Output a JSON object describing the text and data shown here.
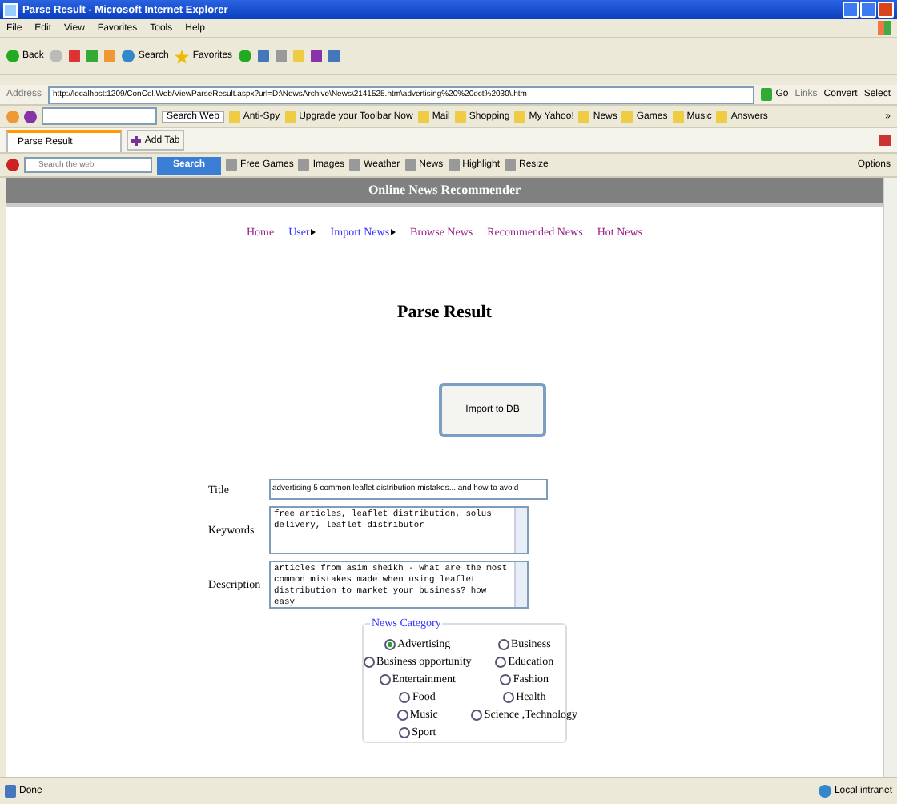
{
  "window": {
    "title": "Parse Result - Microsoft Internet Explorer"
  },
  "menu": [
    "File",
    "Edit",
    "View",
    "Favorites",
    "Tools",
    "Help"
  ],
  "nav_toolbar": {
    "back": "Back",
    "search": "Search",
    "favorites": "Favorites"
  },
  "address_bar": {
    "label": "Address",
    "url": "http://localhost:1209/ConCol.Web/ViewParseResult.aspx?url=D:\\NewsArchive\\News\\2141525.htm\\advertising%20%20oct%2030\\.htm",
    "go": "Go",
    "links": "Links",
    "convert": "Convert",
    "select": "Select"
  },
  "yahoo_toolbar": {
    "search_button": "Search Web",
    "items": [
      "Anti-Spy",
      "Upgrade your Toolbar Now",
      "Mail",
      "Shopping",
      "My Yahoo!",
      "News",
      "Games",
      "Music",
      "Answers"
    ],
    "more": "»"
  },
  "tabs": [
    {
      "label": "Parse Result",
      "selected": true
    }
  ],
  "add_tab": "Add Tab",
  "search_toolbar": {
    "placeholder": "Search the web",
    "button": "Search",
    "items": [
      "Free Games",
      "Images",
      "Weather",
      "News",
      "Highlight",
      "Resize"
    ],
    "options": "Options"
  },
  "page": {
    "header": "Online News Recommender",
    "nav": [
      {
        "label": "Home",
        "visited": true,
        "submenu": false
      },
      {
        "label": "User",
        "visited": false,
        "submenu": true
      },
      {
        "label": "Import News",
        "visited": false,
        "submenu": true
      },
      {
        "label": "Browse News",
        "visited": true,
        "submenu": false
      },
      {
        "label": "Recommended News",
        "visited": true,
        "submenu": false
      },
      {
        "label": "Hot News",
        "visited": true,
        "submenu": false
      }
    ],
    "heading": "Parse Result",
    "import_button": "Import to DB",
    "fields": [
      {
        "label": "Title",
        "kind": "input",
        "value": "advertising 5 common leaflet distribution mistakes... and how to avoid"
      },
      {
        "label": "Keywords",
        "kind": "textarea",
        "value": "free articles, leaflet distribution, solus delivery, leaflet distributor"
      },
      {
        "label": "Description",
        "kind": "textarea",
        "value": "articles from asim sheikh - what are the most common mistakes made when using leaflet distribution to market your business? how easy"
      }
    ],
    "category": {
      "legend": "News Category",
      "options": [
        {
          "label": "Advertising",
          "selected": true
        },
        {
          "label": "Business",
          "selected": false
        },
        {
          "label": "Business opportunity",
          "selected": false
        },
        {
          "label": "Education",
          "selected": false
        },
        {
          "label": "Entertainment",
          "selected": false
        },
        {
          "label": "Fashion",
          "selected": false
        },
        {
          "label": "Food",
          "selected": false
        },
        {
          "label": "Health",
          "selected": false
        },
        {
          "label": "Music",
          "selected": false
        },
        {
          "label": "Science ,Technology",
          "selected": false
        },
        {
          "label": "Sport",
          "selected": false
        }
      ]
    }
  },
  "status_bar": {
    "text": "Done",
    "zone": "Local intranet"
  }
}
